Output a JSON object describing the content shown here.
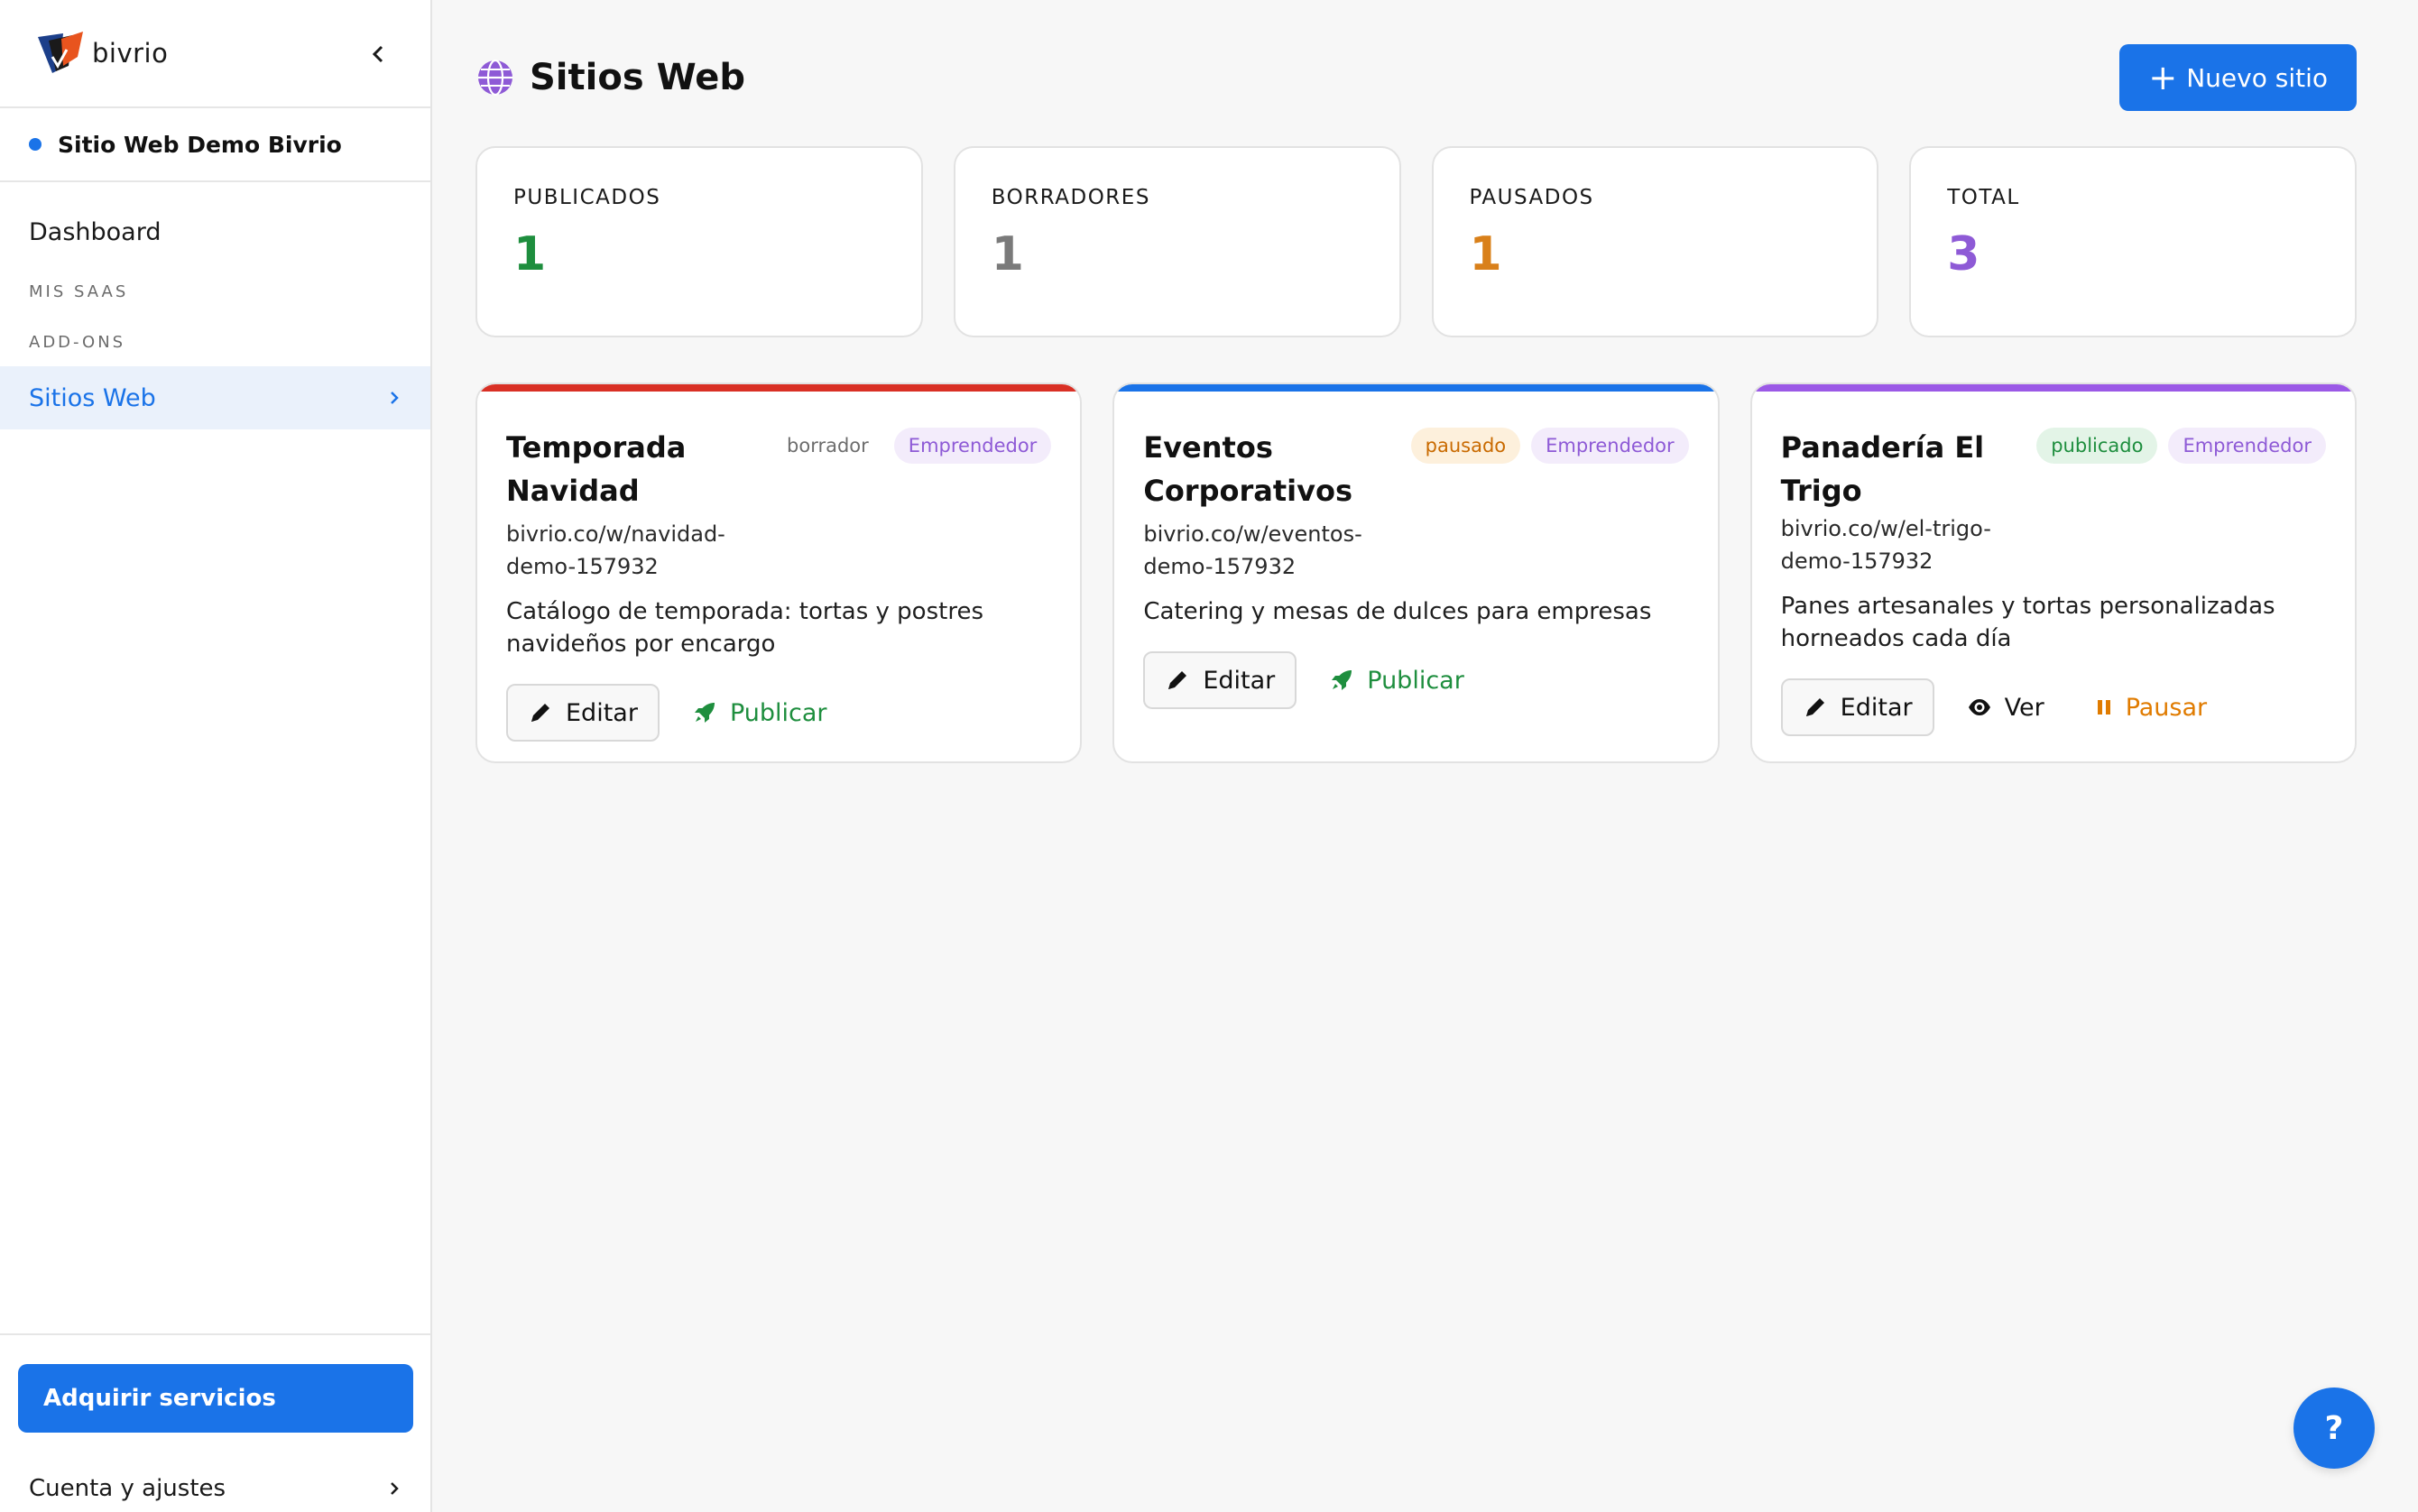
{
  "brand": {
    "name": "bivrio"
  },
  "site_selector": {
    "name": "Sitio Web Demo Bivrio"
  },
  "nav": {
    "dashboard": "Dashboard",
    "section_saas": "MIS SAAS",
    "section_addons": "ADD-ONS",
    "sitios_web": "Sitios Web"
  },
  "sidebar_bottom": {
    "acquire": "Adquirir servicios",
    "account": "Cuenta y ajustes"
  },
  "header": {
    "title": "Sitios Web",
    "new_button": "Nuevo sitio"
  },
  "stats": [
    {
      "label": "PUBLICADOS",
      "value": "1",
      "color": "#1e8e3e"
    },
    {
      "label": "BORRADORES",
      "value": "1",
      "color": "#7a7a7a"
    },
    {
      "label": "PAUSADOS",
      "value": "1",
      "color": "#d9801a"
    },
    {
      "label": "TOTAL",
      "value": "3",
      "color": "#8e5ad6"
    }
  ],
  "sites": [
    {
      "title_line1": "Temporada",
      "title_line2": "Navidad",
      "status": "borrador",
      "plan": "Emprendedor",
      "url_line1": "bivrio.co/w/navidad-",
      "url_line2": "demo-157932",
      "desc_line1": "Catálogo de temporada: tortas y postres",
      "desc_line2": "navideños por encargo",
      "edit": "Editar",
      "action": "Publicar",
      "accent": "#d93025"
    },
    {
      "title_line1": "Eventos",
      "title_line2": "Corporativos",
      "status": "pausado",
      "plan": "Emprendedor",
      "url_line1": "bivrio.co/w/eventos-",
      "url_line2": "demo-157932",
      "desc_line1": "Catering y mesas de dulces para empresas",
      "edit": "Editar",
      "action": "Publicar",
      "accent": "#1a73e8"
    },
    {
      "title_line1": "Panadería El Trigo",
      "status": "publicado",
      "plan": "Emprendedor",
      "url_line1": "bivrio.co/w/el-trigo-",
      "url_line2": "demo-157932",
      "desc_line1": "Panes artesanales y tortas personalizadas",
      "desc_line2": "horneados cada día",
      "edit": "Editar",
      "view": "Ver",
      "pause": "Pausar",
      "accent": "#9b59e6"
    }
  ],
  "colors": {
    "primary": "#1a73e8",
    "publish_green": "#1e8e3e",
    "pause_orange": "#e07b00"
  },
  "help": {
    "label": "?"
  }
}
